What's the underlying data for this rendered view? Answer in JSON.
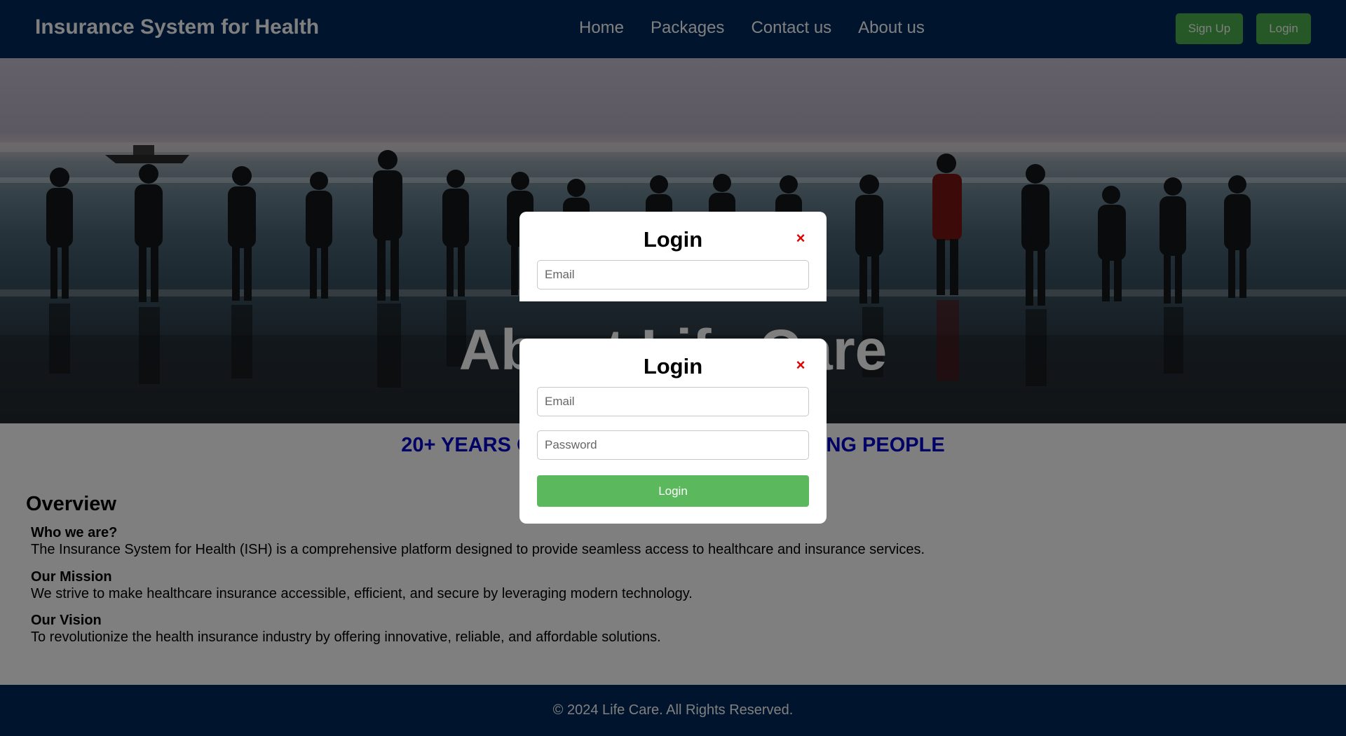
{
  "navbar": {
    "brand": "Insurance System for Health",
    "links": [
      "Home",
      "Packages",
      "Contact us",
      "About us"
    ],
    "signup_label": "Sign Up",
    "login_label": "Login"
  },
  "hero": {
    "title": "About Life Care",
    "subtitle": "Life Care"
  },
  "tagline": "20+ YEARS OF EXPERIENCE IN EMPOWERING PEOPLE",
  "overview": {
    "title": "Overview",
    "sections": [
      {
        "heading": "Who we are?",
        "text": "The Insurance System for Health (ISH) is a comprehensive platform designed to provide seamless access to healthcare and insurance services."
      },
      {
        "heading": "Our Mission",
        "text": "We strive to make healthcare insurance accessible, efficient, and secure by leveraging modern technology."
      },
      {
        "heading": "Our Vision",
        "text": "To revolutionize the health insurance industry by offering innovative, reliable, and affordable solutions."
      }
    ]
  },
  "footer": {
    "text": "© 2024 Life Care. All Rights Reserved."
  },
  "modal_back": {
    "title": "Login",
    "close": "×",
    "email_placeholder": "Email"
  },
  "modal_front": {
    "title": "Login",
    "close": "×",
    "email_placeholder": "Email",
    "password_placeholder": "Password",
    "submit_label": "Login"
  },
  "colors": {
    "navbar_bg": "#03295a",
    "button_green": "#5cb85c",
    "tagline_blue": "#0000cc",
    "close_red": "#e00000"
  },
  "icons": {
    "close": "close-icon"
  }
}
